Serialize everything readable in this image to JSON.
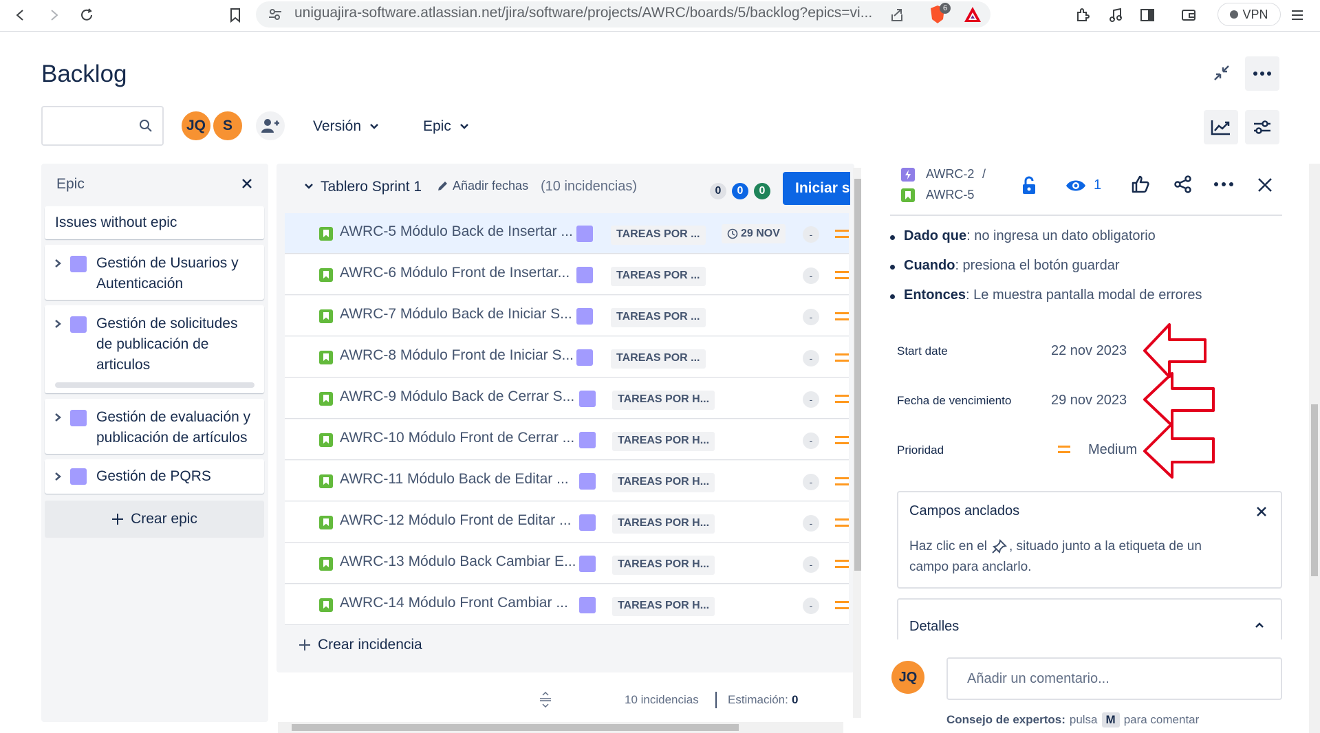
{
  "browser": {
    "url": "uniguajira-software.atlassian.net/jira/software/projects/AWRC/boards/5/backlog?epics=vi...",
    "brave_badge": "6",
    "vpn_label": "VPN"
  },
  "header": {
    "title": "Backlog",
    "avatars": [
      {
        "initials": "JQ",
        "color": "#f79232"
      },
      {
        "initials": "S",
        "color": "#f79232"
      }
    ],
    "filters": [
      {
        "label": "Versión"
      },
      {
        "label": "Epic"
      }
    ]
  },
  "epic_panel": {
    "title": "Epic",
    "without_epic": "Issues without epic",
    "epics": [
      {
        "line1": "Gestión de Usuarios y",
        "line2": "Autenticación",
        "line3": ""
      },
      {
        "line1": "Gestión de solicitudes",
        "line2": "de publicación de",
        "line3": "articulos"
      },
      {
        "line1": "Gestión de evaluación y",
        "line2": "publicación de artículos",
        "line3": ""
      },
      {
        "line1": "Gestión de PQRS",
        "line2": "",
        "line3": ""
      }
    ],
    "create_epic": "Crear epic"
  },
  "sprint": {
    "name": "Tablero Sprint 1",
    "add_dates": "Añadir fechas",
    "count_label": "(10 incidencias)",
    "counters": [
      "0",
      "0",
      "0"
    ],
    "start_button": "Iniciar sp",
    "rows": [
      {
        "text": "AWRC-5 Módulo Back de Insertar ...",
        "status": "TAREAS POR ...",
        "due": "29 NOV",
        "est": "-"
      },
      {
        "text": "AWRC-6 Módulo Front de Insertar...",
        "status": "TAREAS POR ...",
        "due": "",
        "est": "-"
      },
      {
        "text": "AWRC-7 Módulo Back de Iniciar S...",
        "status": "TAREAS POR ...",
        "due": "",
        "est": "-"
      },
      {
        "text": "AWRC-8 Módulo Front de Iniciar S...",
        "status": "TAREAS POR ...",
        "due": "",
        "est": "-"
      },
      {
        "text": "AWRC-9 Módulo Back de Cerrar S...",
        "status": "TAREAS POR H...",
        "due": "",
        "est": "-"
      },
      {
        "text": "AWRC-10 Módulo Front de Cerrar ...",
        "status": "TAREAS POR H...",
        "due": "",
        "est": "-"
      },
      {
        "text": "AWRC-11 Módulo Back de Editar ...",
        "status": "TAREAS POR H...",
        "due": "",
        "est": "-"
      },
      {
        "text": "AWRC-12 Módulo Front de Editar ...",
        "status": "TAREAS POR H...",
        "due": "",
        "est": "-"
      },
      {
        "text": "AWRC-13 Módulo Back Cambiar E...",
        "status": "TAREAS POR H...",
        "due": "",
        "est": "-"
      },
      {
        "text": "AWRC-14 Módulo Front Cambiar ...",
        "status": "TAREAS POR H...",
        "due": "",
        "est": "-"
      }
    ],
    "create_issue": "Crear incidencia",
    "footer_count": "10 incidencias",
    "footer_estimate_label": "Estimación:",
    "footer_estimate_value": "0"
  },
  "detail": {
    "breadcrumb_parent": "AWRC-2",
    "breadcrumb_sep": "/",
    "breadcrumb_current": "AWRC-5",
    "watch_count": "1",
    "bullets": [
      {
        "term": "Dado que",
        "text": ": no ingresa un dato obligatorio"
      },
      {
        "term": "Cuando",
        "text": ":  presiona el botón guardar"
      },
      {
        "term": "Entonces",
        "text": ":  Le muestra pantalla modal de errores"
      }
    ],
    "fields": {
      "start_date_label": "Start date",
      "start_date_value": "22 nov 2023",
      "due_date_label": "Fecha de vencimiento",
      "due_date_value": "29 nov 2023",
      "priority_label": "Prioridad",
      "priority_value": "Medium"
    },
    "pinned": {
      "title": "Campos anclados",
      "text_before": "Haz clic en el",
      "text_after": ", situado junto a la etiqueta de un",
      "text_line2": "campo para anclarlo."
    },
    "details_section": "Detalles",
    "comment_avatar": "JQ",
    "comment_placeholder": "Añadir un comentario...",
    "tip_bold": "Consejo de expertos:",
    "tip_mid": "pulsa",
    "tip_key": "M",
    "tip_end": "para comentar"
  },
  "colors": {
    "accent": "#0c66e4",
    "epic_purple": "#a29bfe",
    "story_green": "#63ba3c",
    "priority_orange": "#ff991f",
    "annotation_red": "#e3001b"
  }
}
